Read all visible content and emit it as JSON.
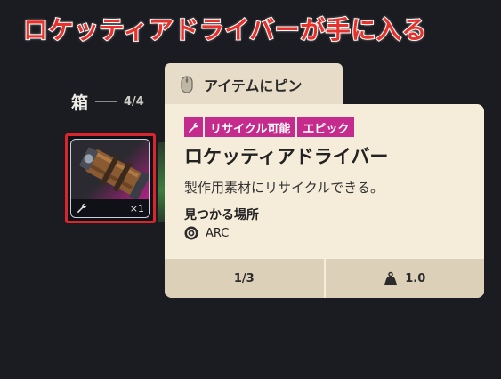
{
  "headline": "ロケッティアドライバーが手に入る",
  "container": {
    "title": "箱",
    "count": "4/4"
  },
  "slot": {
    "quantity": "×1"
  },
  "pin_tab": {
    "label": "アイテムにピン"
  },
  "tooltip": {
    "tags": [
      "リサイクル可能",
      "エピック"
    ],
    "item_name": "ロケッティアドライバー",
    "description": "製作用素材にリサイクルできる。",
    "found_title": "見つかる場所",
    "location": "ARC",
    "stack": "1/3",
    "weight": "1.0"
  },
  "colors": {
    "accent_red": "#e8312b",
    "tag_magenta": "#c42b8c",
    "card_bg": "#f6ecda"
  },
  "icons": [
    "mouse-icon",
    "wrench-icon",
    "arc-icon",
    "weight-icon"
  ]
}
